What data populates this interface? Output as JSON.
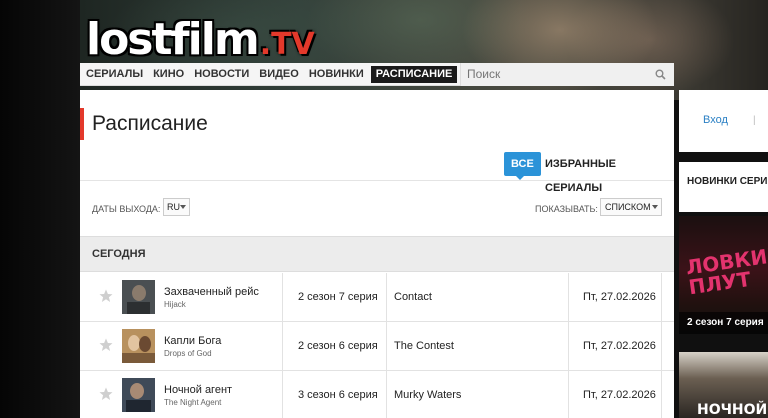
{
  "logo": {
    "main": "lostfilm",
    "tld": ".TV"
  },
  "nav": {
    "items": [
      "СЕРИАЛЫ",
      "КИНО",
      "НОВОСТИ",
      "ВИДЕО",
      "НОВИНКИ",
      "РАСПИСАНИЕ"
    ],
    "active_index": 5
  },
  "search": {
    "placeholder": "Поиск",
    "icon": "search-icon"
  },
  "page": {
    "title": "Расписание",
    "filters": {
      "all": "ВСЕ",
      "favorites": "ИЗБРАННЫЕ СЕРИАЛЫ"
    },
    "dates_label": "ДАТЫ ВЫХОДА:",
    "dates_value": "RU",
    "show_label": "ПОКАЗЫВАТЬ:",
    "show_value": "СПИСКОМ",
    "section": "СЕГОДНЯ"
  },
  "schedule": [
    {
      "title": "Захваченный рейс",
      "original": "Hijack",
      "episode": "2 сезон 7 серия",
      "episode_title": "Contact",
      "date": "Пт, 27.02.2026"
    },
    {
      "title": "Капли Бога",
      "original": "Drops of God",
      "episode": "2 сезон 6 серия",
      "episode_title": "The Contest",
      "date": "Пт, 27.02.2026"
    },
    {
      "title": "Ночной агент",
      "original": "The Night Agent",
      "episode": "3 сезон 6 серия",
      "episode_title": "Murky Waters",
      "date": "Пт, 27.02.2026"
    }
  ],
  "sidebar": {
    "login": "Вход",
    "separator": "|",
    "new_series": "НОВИНКИ СЕРИ",
    "poster1": {
      "title": "ЛОВКИЙ ПЛУТ",
      "caption": "2 сезон 7 серия"
    },
    "poster2": {
      "title": "НОЧНОЙ"
    }
  },
  "colors": {
    "accent_red": "#e3392b",
    "accent_blue": "#2b93d8",
    "link_blue": "#2b80c4"
  }
}
